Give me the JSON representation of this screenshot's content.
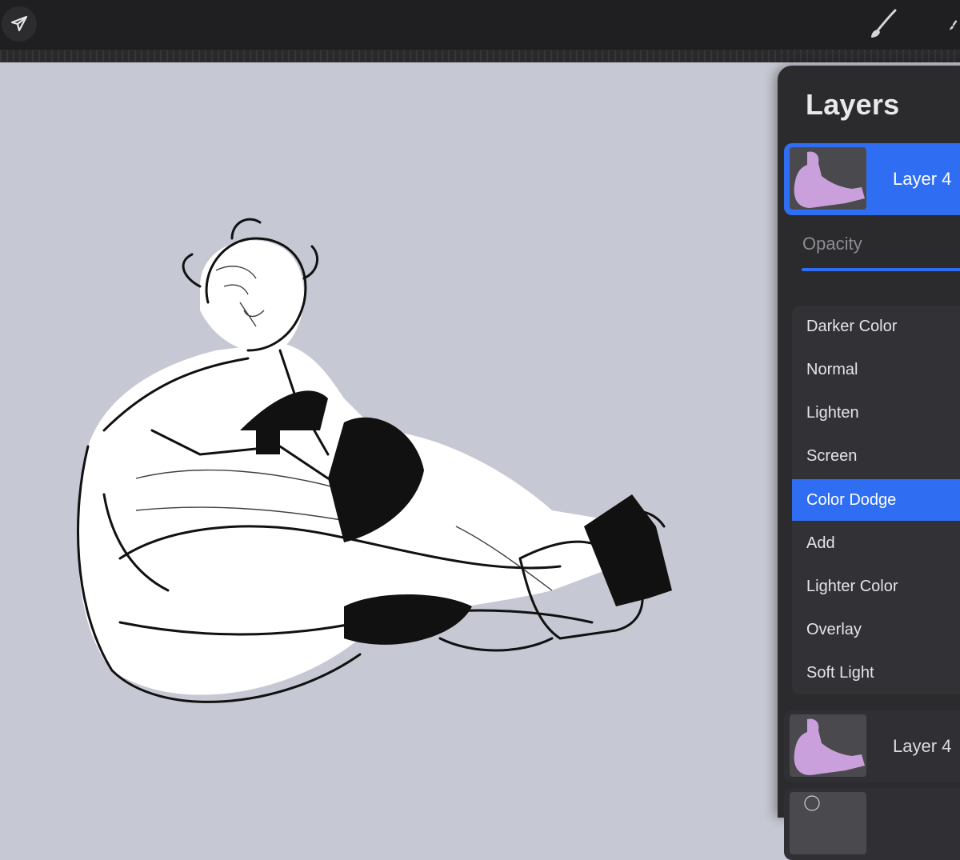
{
  "toolbar": {
    "left_tool": "arrow-cursor-icon",
    "right_tools": [
      "brush-icon",
      "smudge-icon"
    ]
  },
  "canvas": {
    "background": "#c6c9d3",
    "artwork": "line-art-sitting-figure"
  },
  "layers_panel": {
    "title": "Layers",
    "active_layer": {
      "name": "Layer 4"
    },
    "opacity_label": "Opacity",
    "blend_modes": [
      {
        "label": "Darker Color",
        "selected": false
      },
      {
        "label": "Normal",
        "selected": false
      },
      {
        "label": "Lighten",
        "selected": false
      },
      {
        "label": "Screen",
        "selected": false
      },
      {
        "label": "Color Dodge",
        "selected": true
      },
      {
        "label": "Add",
        "selected": false
      },
      {
        "label": "Lighter Color",
        "selected": false
      },
      {
        "label": "Overlay",
        "selected": false
      },
      {
        "label": "Soft Light",
        "selected": false
      }
    ],
    "other_layers": [
      {
        "name": "Layer 4"
      }
    ],
    "colors": {
      "accent": "#2f6ef2",
      "thumbnail_figure": "#c9a0dc",
      "panel": "#2b2b2e"
    }
  }
}
